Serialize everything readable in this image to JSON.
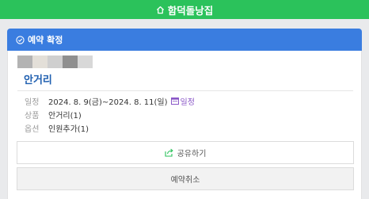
{
  "header": {
    "title": "함덕돌낭집",
    "icon": "home-icon"
  },
  "banner": {
    "status_label": "예약 확정",
    "icon": "check-circle-icon"
  },
  "product": {
    "title": "안거리",
    "thumb_colors": [
      "#b3b3b3",
      "#e3dfd8",
      "#cfcfcf",
      "#8f8f8f",
      "#d8d8d8"
    ]
  },
  "details": {
    "date_label": "일정",
    "date_value": "2024. 8. 9(금)~2024. 8. 11(일)",
    "calendar_link": "일정",
    "product_label": "상품",
    "product_value": "안거리(1)",
    "option_label": "옵션",
    "option_value": "인원추가(1)"
  },
  "actions": {
    "share_label": "공유하기",
    "cancel_label": "예약취소"
  },
  "colors": {
    "topbar": "#2bc25b",
    "banner": "#3a7de0",
    "title": "#1f5fb0",
    "calendar": "#8a57c7"
  }
}
